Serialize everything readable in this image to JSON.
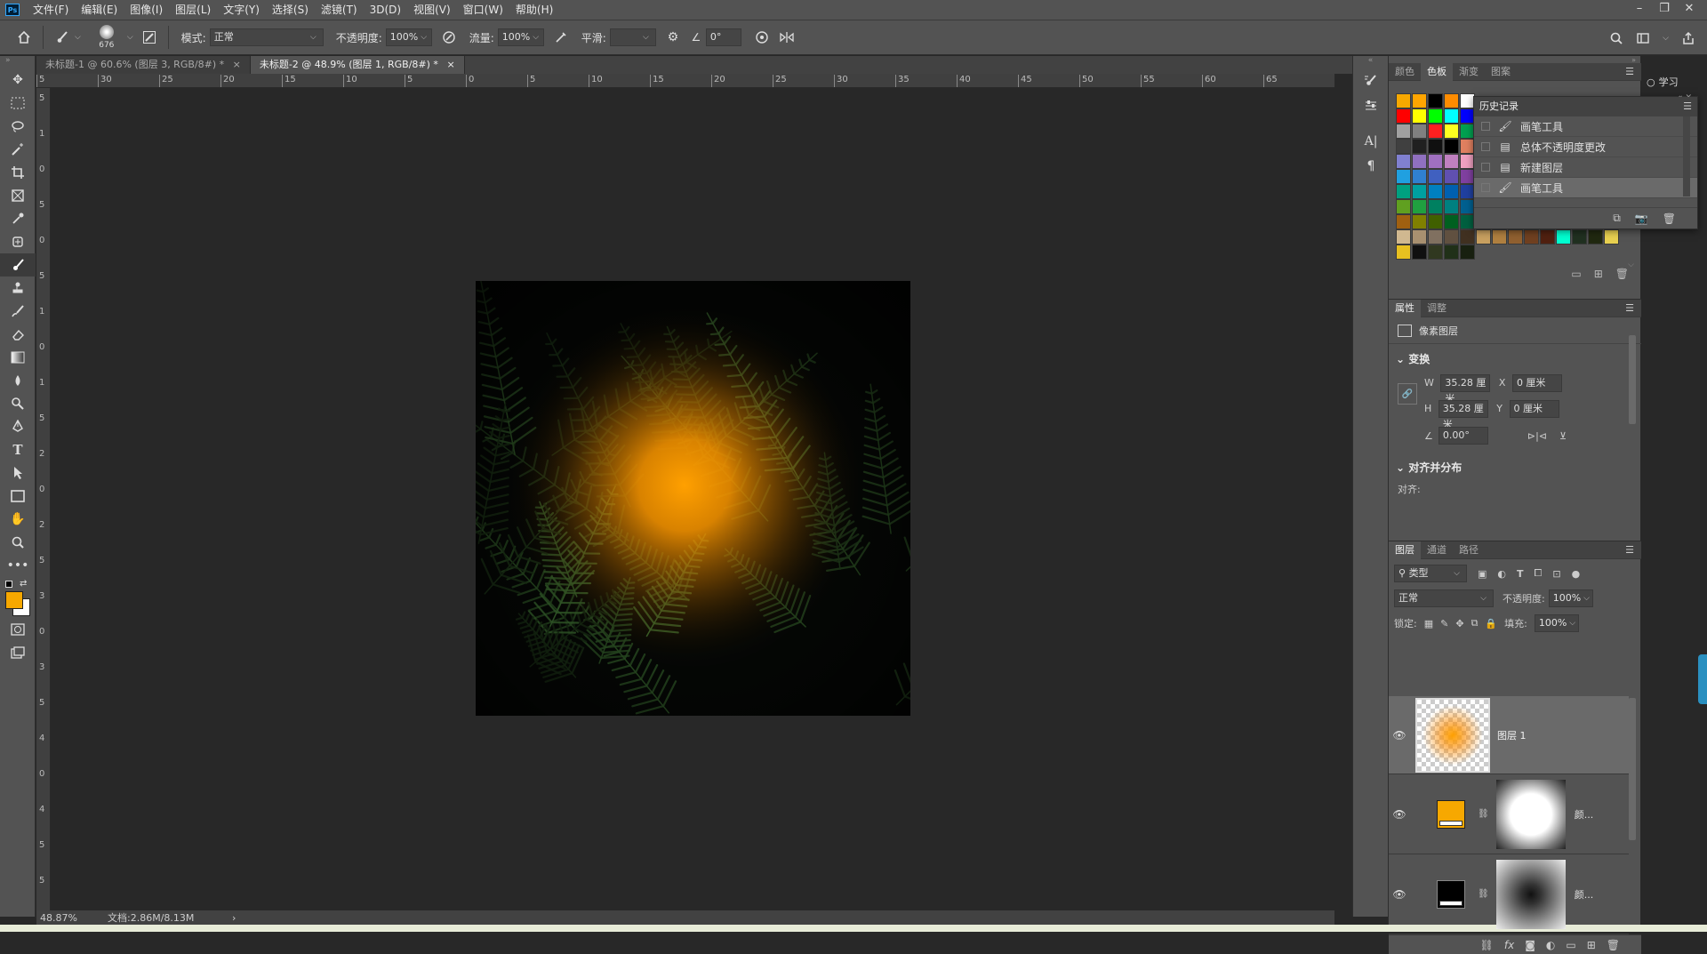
{
  "app": {
    "logo": "Ps"
  },
  "menu": [
    "文件(F)",
    "编辑(E)",
    "图像(I)",
    "图层(L)",
    "文字(Y)",
    "选择(S)",
    "滤镜(T)",
    "3D(D)",
    "视图(V)",
    "窗口(W)",
    "帮助(H)"
  ],
  "window_controls": {
    "minimize": "–",
    "restore": "❐",
    "close": "✕"
  },
  "options": {
    "brush_size": "676",
    "mode_label": "模式:",
    "mode_value": "正常",
    "opacity_label": "不透明度:",
    "opacity_value": "100%",
    "flow_label": "流量:",
    "flow_value": "100%",
    "smooth_label": "平滑:",
    "smooth_value": "",
    "angle_value": "0°"
  },
  "tabs": [
    {
      "label": "未标题-1 @ 60.6% (图层 3, RGB/8#) *",
      "close": "×"
    },
    {
      "label": "未标题-2 @ 48.9% (图层 1, RGB/8#) *",
      "close": "×"
    }
  ],
  "ruler_h": [
    "5",
    "30",
    "25",
    "20",
    "15",
    "10",
    "5",
    "0",
    "5",
    "10",
    "15",
    "20",
    "25",
    "30",
    "35",
    "40",
    "45",
    "50",
    "55",
    "60",
    "65"
  ],
  "ruler_v": [
    "5",
    "1",
    "0",
    "5",
    "0",
    "5",
    "1",
    "0",
    "1",
    "5",
    "2",
    "0",
    "2",
    "5",
    "3",
    "0",
    "3",
    "5",
    "4",
    "0",
    "4",
    "5",
    "5"
  ],
  "status": {
    "zoom": "48.87%",
    "doc": "文档:2.86M/8.13M",
    "arrow": "›"
  },
  "swatch_panel": {
    "tabs": [
      "颜色",
      "色板",
      "渐变",
      "图案"
    ],
    "active": 1
  },
  "swatches": [
    "#f7a800",
    "#ffa500",
    "#000000",
    "#ff8c00",
    "#ffffff",
    "",
    "",
    "",
    "",
    "",
    "",
    "",
    "",
    "",
    "#ff0000",
    "#ffff00",
    "#00ff00",
    "#00ffff",
    "#0000ff",
    "#ff00ff",
    "",
    "",
    "",
    "",
    "",
    "",
    "",
    "",
    "#a0a0a0",
    "#808080",
    "#ff2020",
    "#ffff20",
    "#00a050",
    "#ff9070",
    "",
    "",
    "",
    "",
    "",
    "",
    "",
    "",
    "#404040",
    "#202020",
    "#101010",
    "#000000",
    "#e08060",
    "#f0a0a0",
    "",
    "",
    "",
    "",
    "",
    "",
    "",
    "",
    "#8080d0",
    "#9070c0",
    "#a070c0",
    "#c080c0",
    "#f0a0c0",
    "#f0a0b0",
    "",
    "",
    "",
    "",
    "",
    "",
    "",
    "",
    "#20a0e0",
    "#3080d0",
    "#4060c0",
    "#6050b0",
    "#8040a0",
    "#a04090",
    "",
    "",
    "",
    "",
    "",
    "",
    "",
    "",
    "#00a080",
    "#00a0a0",
    "#0080c0",
    "#0060b0",
    "#2040a0",
    "#6030a0",
    "",
    "",
    "",
    "",
    "",
    "",
    "",
    "",
    "#60a020",
    "#20a040",
    "#008060",
    "#008080",
    "#006090",
    "#203080",
    "",
    "",
    "",
    "",
    "",
    "",
    "",
    "",
    "#a06010",
    "#808000",
    "#406000",
    "#006020",
    "#006040",
    "#005050",
    "#003060",
    "#102050",
    "#301050",
    "#500040",
    "#600030",
    "#600010",
    "#500000",
    "#f0e040",
    "#d0b890",
    "#a89070",
    "#807060",
    "#605040",
    "#403020",
    "#c8a060",
    "#b08040",
    "#906030",
    "#704020",
    "#502010",
    "#00ffd0",
    "#203020",
    "#202810",
    "#e8d050",
    "#e8c020",
    "#101010",
    "#303820",
    "#203018",
    "#182010",
    "",
    "",
    "",
    "",
    "",
    "",
    "",
    "",
    ""
  ],
  "history": {
    "title": "历史记录",
    "items": [
      {
        "icon": "brush-icon",
        "label": "画笔工具"
      },
      {
        "icon": "doc-icon",
        "label": "总体不透明度更改"
      },
      {
        "icon": "doc-icon",
        "label": "新建图层"
      },
      {
        "icon": "brush-icon",
        "label": "画笔工具"
      }
    ]
  },
  "learn_label": "学习",
  "properties": {
    "tabs": [
      "属性",
      "调整"
    ],
    "layer_type": "像素图层",
    "transform_title": "变换",
    "w_label": "W",
    "w_value": "35.28 厘米",
    "h_label": "H",
    "h_value": "35.28 厘米",
    "x_label": "X",
    "x_value": "0 厘米",
    "y_label": "Y",
    "y_value": "0 厘米",
    "angle_value": "0.00°",
    "align_title": "对齐并分布",
    "align_label": "对齐:"
  },
  "layers_panel": {
    "tabs": [
      "图层",
      "通道",
      "路径"
    ],
    "filter_label": "类型",
    "blend_mode": "正常",
    "opacity_label": "不透明度:",
    "opacity_value": "100%",
    "lock_label": "锁定:",
    "fill_label": "填充:",
    "fill_value": "100%",
    "layers": [
      {
        "name": "图层 1",
        "type": "pixel",
        "selected": true
      },
      {
        "name": "颜...",
        "type": "fill",
        "fill_color": "#f7a800",
        "mask": "white-blob"
      },
      {
        "name": "颜...",
        "type": "fill",
        "fill_color": "#000000",
        "mask": "dark-center"
      }
    ],
    "footer_icons": [
      "link-icon",
      "fx-icon",
      "mask-icon",
      "adjustment-icon",
      "folder-icon",
      "new-layer-icon",
      "trash-icon"
    ]
  },
  "colors": {
    "foreground": "#f7a800",
    "background": "#ffffff",
    "accent": "#f7a800"
  }
}
